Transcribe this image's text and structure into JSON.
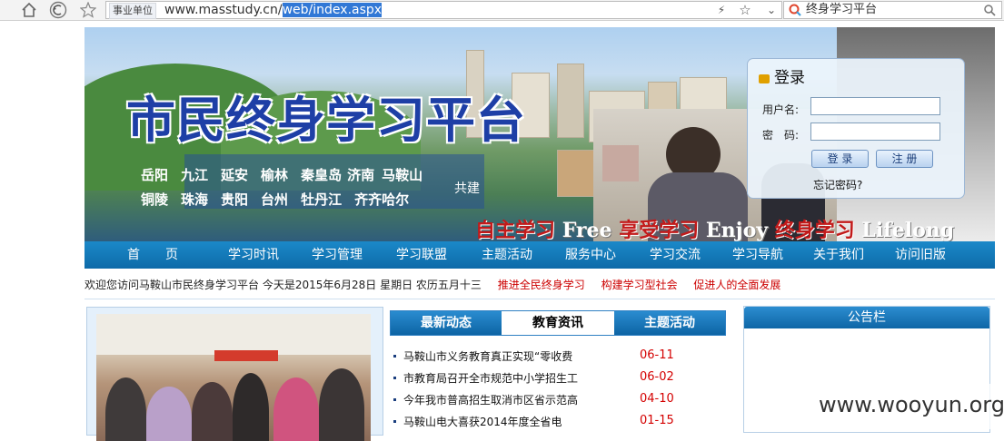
{
  "browser": {
    "badge": "事业单位",
    "url_base": "www.masstudy.cn/",
    "url_selected": "web/index.aspx",
    "search_text": "终身学习平台",
    "icons": [
      "home-icon",
      "back-icon",
      "star-icon",
      "lightning-icon",
      "favorite-star-icon",
      "dropdown-icon",
      "search-engine-icon",
      "search-icon"
    ]
  },
  "banner": {
    "title": "市民终身学习平台",
    "cities_row1": [
      "岳阳",
      "九江",
      "延安",
      "榆林",
      "秦皇岛",
      "济南",
      "马鞍山"
    ],
    "cities_row2": [
      "铜陵",
      "珠海",
      "贵阳",
      "台州",
      "牡丹江",
      "齐齐哈尔"
    ],
    "gongjian": "共建",
    "slogan_1": "自主学习",
    "slogan_1_en": "Free",
    "slogan_2": "享受学习",
    "slogan_2_en": "Enjoy",
    "slogan_3": "终身学习",
    "slogan_3_en": "Lifelong"
  },
  "login": {
    "title": "登录",
    "username_label": "用户名:",
    "password_label": "密　码:",
    "login_button": "登 录",
    "register_button": "注 册",
    "forgot_link": "忘记密码?"
  },
  "nav": [
    "首　　页",
    "学习时讯",
    "学习管理",
    "学习联盟",
    "主题活动",
    "服务中心",
    "学习交流",
    "学习导航",
    "关于我们",
    "访问旧版"
  ],
  "info": {
    "welcome": "欢迎您访问马鞍山市民终身学习平台 今天是2015年6月28日 星期日 农历五月十三",
    "slogans": [
      "推进全民终身学习",
      "构建学习型社会",
      "促进人的全面发展"
    ]
  },
  "tabs": [
    {
      "label": "最新动态",
      "active": false
    },
    {
      "label": "教育资讯",
      "active": true
    },
    {
      "label": "主题活动",
      "active": false
    }
  ],
  "news": [
    {
      "title": "马鞍山市义务教育真正实现“零收费",
      "date": "06-11"
    },
    {
      "title": "市教育局召开全市规范中小学招生工",
      "date": "06-02"
    },
    {
      "title": "今年我市普高招生取消市区省示范高",
      "date": "04-10"
    },
    {
      "title": "马鞍山电大喜获2014年度全省电",
      "date": "01-15"
    }
  ],
  "notice_title": "公告栏",
  "watermark": "www.wooyun.org"
}
